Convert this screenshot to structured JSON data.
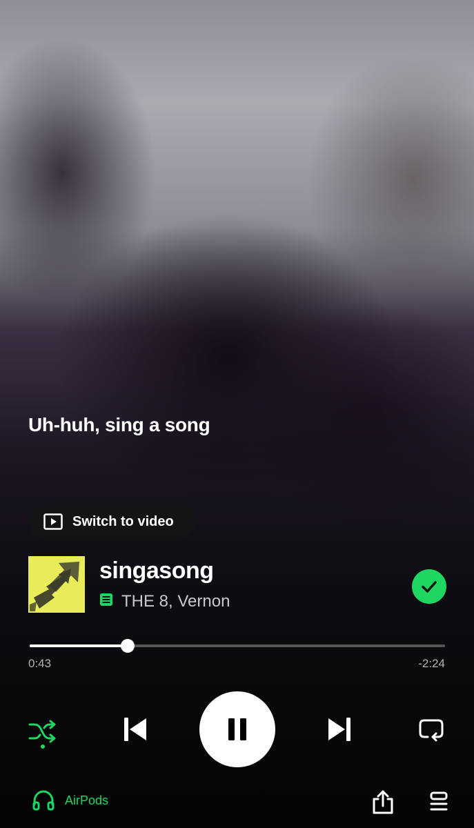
{
  "lyrics": {
    "current_line": "Uh-huh, sing a song"
  },
  "switch_video": {
    "label": "Switch to video"
  },
  "track": {
    "title": "singasong",
    "artists": "THE 8, Vernon",
    "art_color": "#e7ec58",
    "saved": true
  },
  "progress": {
    "elapsed": "0:43",
    "remaining": "-2:24",
    "fraction": 0.2356
  },
  "controls": {
    "shuffle": {
      "icon": "shuffle-icon",
      "active": true
    },
    "previous": {
      "icon": "skip-previous-icon"
    },
    "play_pause": {
      "icon": "pause-icon",
      "state": "playing"
    },
    "next": {
      "icon": "skip-next-icon"
    },
    "repeat": {
      "icon": "repeat-icon",
      "active": false
    }
  },
  "footer": {
    "device": {
      "label": "AirPods",
      "icon": "headphones-icon"
    },
    "share": {
      "icon": "share-icon"
    },
    "queue": {
      "icon": "queue-icon"
    }
  },
  "colors": {
    "accent": "#1ed760",
    "text_primary": "#ffffff",
    "text_secondary": "#b3b3b3"
  }
}
